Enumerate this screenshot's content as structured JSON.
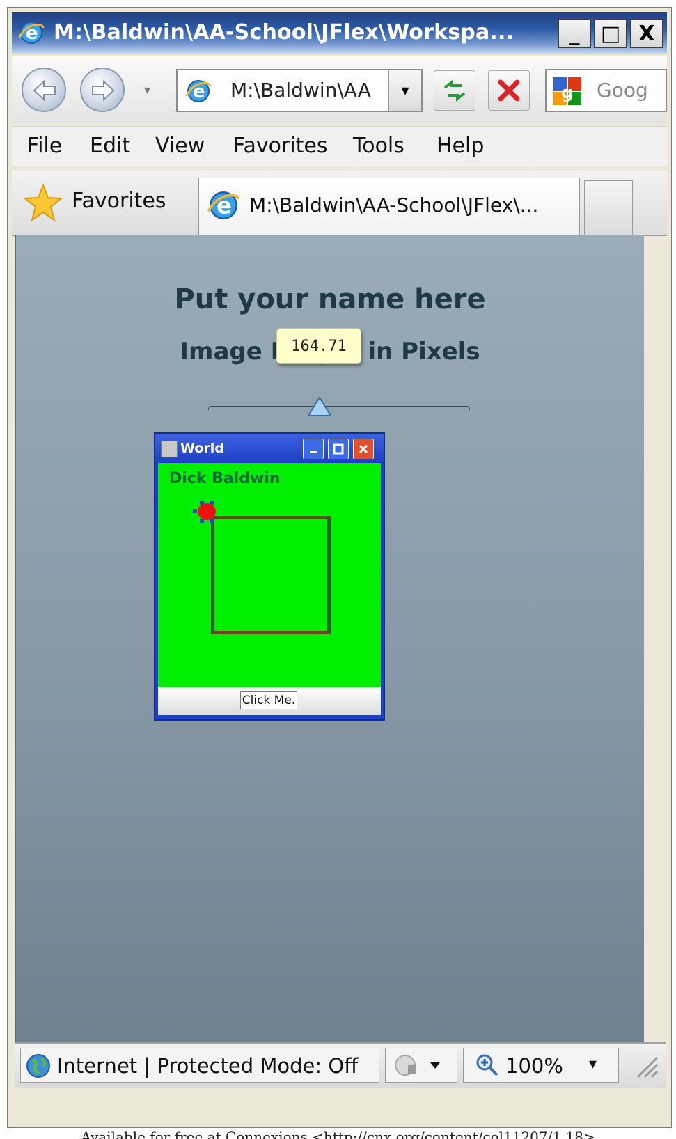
{
  "window": {
    "title": "M:\\Baldwin\\AA-School\\JFlex\\Workspa...",
    "minimize_glyph": "_",
    "maximize_glyph": "□",
    "close_glyph": "X"
  },
  "navbar": {
    "address_text": "M:\\Baldwin\\AA",
    "search_text": "Goog",
    "dropdown_glyph": "▾"
  },
  "menubar": {
    "items": [
      "File",
      "Edit",
      "View",
      "Favorites",
      "Tools",
      "Help"
    ]
  },
  "tabbar": {
    "favorites_label": "Favorites",
    "active_tab_label": "M:\\Baldwin\\AA-School\\JFlex\\..."
  },
  "content": {
    "title": "Put your name here",
    "subtitle": "Image Height in Pixels",
    "tooltip_value": "164.71"
  },
  "java_window": {
    "title": "World",
    "turtle_name": "Dick Baldwin",
    "button_label": "Click Me."
  },
  "statusbar": {
    "zone_text": "Internet | Protected Mode: Off",
    "zoom_text": "100%"
  },
  "caption": "Available for free at Connexions <http://cnx.org/content/col11207/1.18>",
  "icons": {
    "browser": "internet-explorer-icon",
    "back": "back-arrow-icon",
    "forward": "forward-arrow-icon",
    "refresh": "refresh-icon",
    "stop": "stop-icon",
    "favorites": "star-icon",
    "status": "globe-icon",
    "zoom": "magnifier-icon"
  },
  "colors": {
    "title_bar": "#2b5aa6",
    "content_bg": "#8a9aa8",
    "java_canvas": "#00ee00",
    "tooltip_bg": "#ffffcc"
  }
}
